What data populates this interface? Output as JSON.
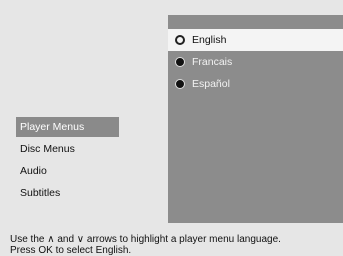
{
  "menu": {
    "items": [
      {
        "label": "Player Menus",
        "selected": true
      },
      {
        "label": "Disc Menus",
        "selected": false
      },
      {
        "label": "Audio",
        "selected": false
      },
      {
        "label": "Subtitles",
        "selected": false
      }
    ]
  },
  "options": {
    "items": [
      {
        "label": "English",
        "selected": true
      },
      {
        "label": "Francais",
        "selected": false
      },
      {
        "label": "Español",
        "selected": false
      }
    ]
  },
  "help": {
    "line1": "Use the ∧ and ∨ arrows to highlight a player menu language.",
    "line2": "Press OK to select English."
  },
  "colors": {
    "background": "#e6e6e6",
    "panel": "#8c8c8c",
    "highlight": "#f4f4f4",
    "menu_selected": "#8a8a8a"
  }
}
